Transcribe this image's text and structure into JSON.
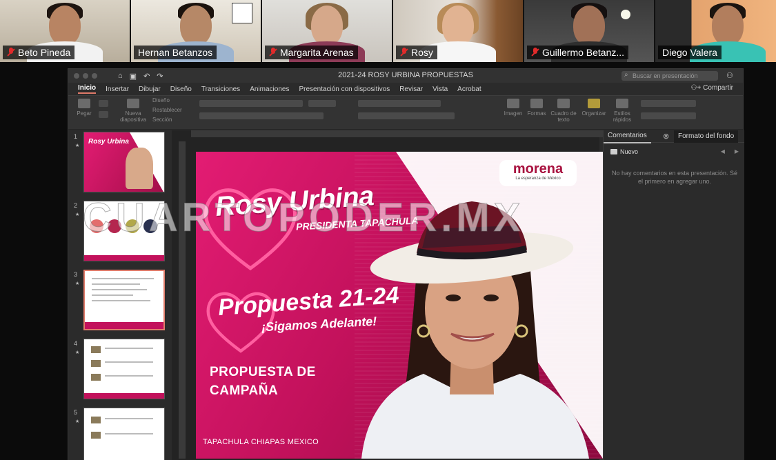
{
  "participants": [
    {
      "name": "Beto Pineda",
      "muted": true
    },
    {
      "name": "Hernan Betanzos",
      "muted": false,
      "active": true
    },
    {
      "name": "Margarita Arenas",
      "muted": true
    },
    {
      "name": "Rosy",
      "muted": true
    },
    {
      "name": "Guillermo Betanz...",
      "muted": true
    },
    {
      "name": "Diego Valera",
      "muted": false
    }
  ],
  "window": {
    "doc_title": "2021-24 ROSY URBINA PROPUESTAS",
    "search_placeholder": "Buscar en presentación",
    "share_label": "Compartir"
  },
  "ribbon": {
    "tabs": [
      "Inicio",
      "Insertar",
      "Dibujar",
      "Diseño",
      "Transiciones",
      "Animaciones",
      "Presentación con dispositivos",
      "Revisar",
      "Vista",
      "Acrobat"
    ],
    "active_tab": "Inicio",
    "groups": {
      "paste": "Pegar",
      "new_slide": "Nueva diapositiva",
      "layout": "Diseño",
      "reset": "Restablecer",
      "section": "Sección",
      "image": "Imagen",
      "shapes": "Formas",
      "textbox": "Cuadro de texto",
      "arrange": "Organizar",
      "quick_styles": "Estilos rápidos"
    }
  },
  "thumbnails": [
    {
      "num": "1",
      "selected": false
    },
    {
      "num": "2",
      "selected": false
    },
    {
      "num": "3",
      "selected": true
    },
    {
      "num": "4",
      "selected": false
    },
    {
      "num": "5",
      "selected": false
    }
  ],
  "slide": {
    "brand": "morena",
    "brand_tagline": "La esperanza de México",
    "name": "Rosy Urbina",
    "subtitle": "PRESIDENTA TAPACHULA",
    "proposal": "Propuesta 21-24",
    "proposal_sub": "¡Sigamos Adelante!",
    "campaign_line1": "PROPUESTA DE",
    "campaign_line2": "CAMPAÑA",
    "location": "TAPACHULA CHIAPAS MEXICO"
  },
  "comments_pane": {
    "tab_comments": "Comentarios",
    "tab_format": "Formato del fondo",
    "new_label": "Nuevo",
    "empty_message": "No hay comentarios en esta presentación. Sé el primero en agregar uno."
  },
  "watermark": "CUARTOPODER.MX",
  "colors": {
    "accent_pink": "#e31c73",
    "active_speaker": "#b5e86a",
    "muted_red": "#e02b2b"
  }
}
